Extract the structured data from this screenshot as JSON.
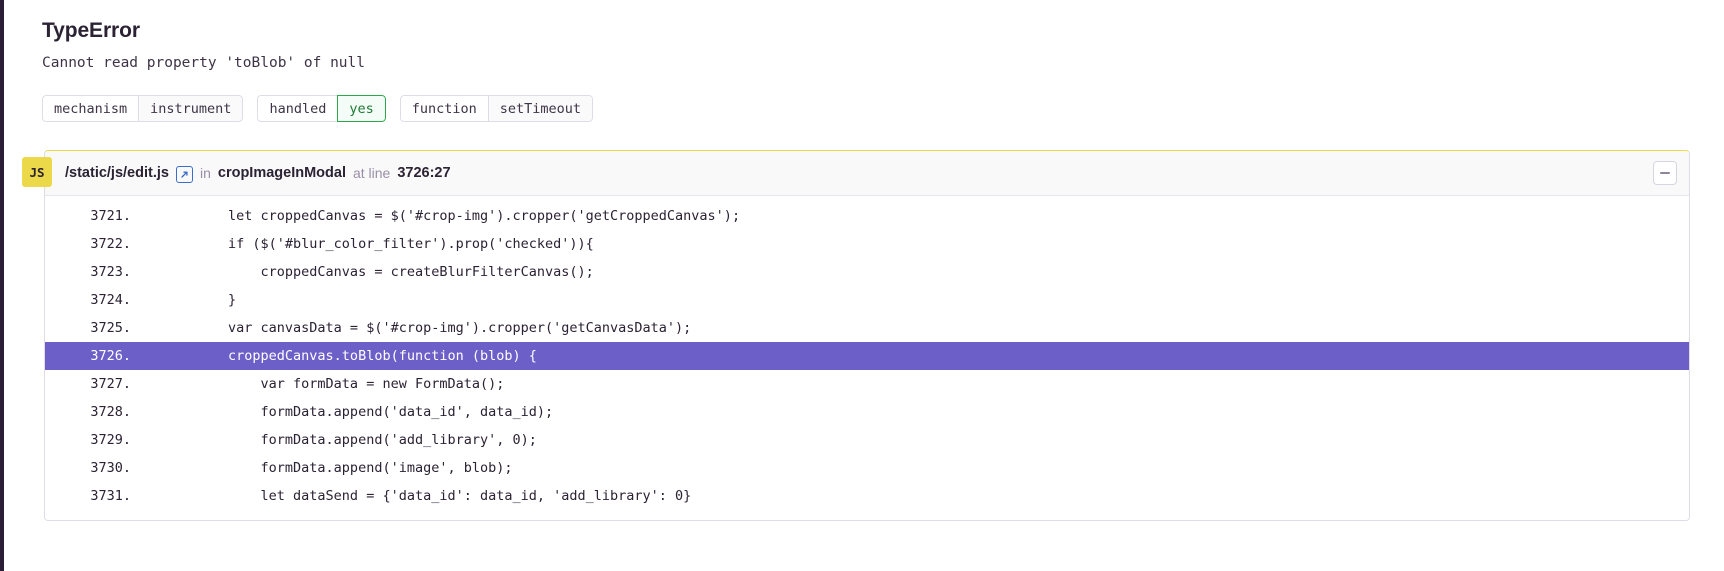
{
  "error": {
    "type": "TypeError",
    "message": "Cannot read property 'toBlob' of null"
  },
  "tags": [
    {
      "key": "mechanism",
      "value": "instrument",
      "state": "default"
    },
    {
      "key": "handled",
      "value": "yes",
      "state": "ok"
    },
    {
      "key": "function",
      "value": "setTimeout",
      "state": "default"
    }
  ],
  "frame": {
    "language_badge": "JS",
    "filename": "/static/js/edit.js",
    "link_icon": "external-link-icon",
    "in_word": "in",
    "function_name": "cropImageInModal",
    "at_line_word": "at line",
    "line_ref": "3726:27",
    "collapse_label": "−",
    "accent_color": "#6c5fc7",
    "badge_color": "#ecd94a",
    "lines": [
      {
        "number": "3721.",
        "code": "        let croppedCanvas = $('#crop-img').cropper('getCroppedCanvas');",
        "active": false
      },
      {
        "number": "3722.",
        "code": "        if ($('#blur_color_filter').prop('checked')){",
        "active": false
      },
      {
        "number": "3723.",
        "code": "            croppedCanvas = createBlurFilterCanvas();",
        "active": false
      },
      {
        "number": "3724.",
        "code": "        }",
        "active": false
      },
      {
        "number": "3725.",
        "code": "        var canvasData = $('#crop-img').cropper('getCanvasData');",
        "active": false
      },
      {
        "number": "3726.",
        "code": "        croppedCanvas.toBlob(function (blob) {",
        "active": true
      },
      {
        "number": "3727.",
        "code": "            var formData = new FormData();",
        "active": false
      },
      {
        "number": "3728.",
        "code": "            formData.append('data_id', data_id);",
        "active": false
      },
      {
        "number": "3729.",
        "code": "            formData.append('add_library', 0);",
        "active": false
      },
      {
        "number": "3730.",
        "code": "            formData.append('image', blob);",
        "active": false
      },
      {
        "number": "3731.",
        "code": "            let dataSend = {'data_id': data_id, 'add_library': 0}",
        "active": false
      }
    ]
  }
}
